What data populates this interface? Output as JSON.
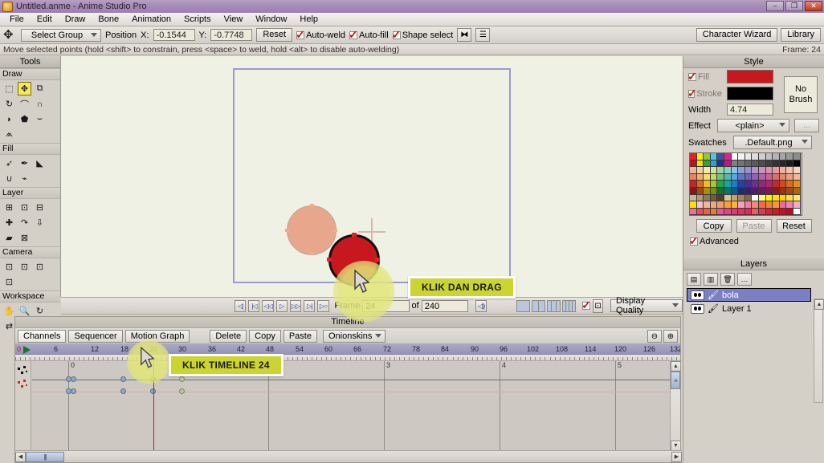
{
  "window": {
    "title": "Untitled.anme - Anime Studio Pro",
    "app_icon": "anime-studio-icon",
    "minimize": "–",
    "maximize": "❐",
    "close": "✕"
  },
  "menubar": {
    "items": [
      "File",
      "Edit",
      "Draw",
      "Bone",
      "Animation",
      "Scripts",
      "View",
      "Window",
      "Help"
    ]
  },
  "optionsbar": {
    "tool_icon": "move-tool-icon",
    "group_select": "Select Group",
    "position_label": "Position",
    "x_label": "X:",
    "x_value": "-0.1544",
    "y_label": "Y:",
    "y_value": "-0.7748",
    "reset": "Reset",
    "auto_weld": "Auto-weld",
    "auto_fill": "Auto-fill",
    "shape_select": "Shape select",
    "icon1": "flip-horizontal-icon",
    "icon2": "point-list-icon",
    "character_wizard": "Character Wizard",
    "library": "Library"
  },
  "statusbar": {
    "hint": "Move selected points (hold <shift> to constrain, press <space> to weld, hold <alt> to disable auto-welding)",
    "frame": "Frame: 24"
  },
  "tools": {
    "title": "Tools",
    "sections": [
      {
        "name": "Draw",
        "tools": [
          {
            "name": "select-points-tool",
            "glyph": "⬚",
            "selected": false
          },
          {
            "name": "translate-points-tool",
            "glyph": "✥",
            "selected": true
          },
          {
            "name": "scale-points-tool",
            "glyph": "⧉",
            "selected": false
          },
          {
            "name": "rotate-points-tool",
            "glyph": "↻",
            "selected": false
          },
          {
            "name": "add-point-tool",
            "glyph": "⌒",
            "selected": false
          },
          {
            "name": "curvature-tool",
            "glyph": "∩",
            "selected": false
          },
          {
            "name": "delete-edge-tool",
            "glyph": "◗",
            "selected": false
          },
          {
            "name": "perspective-points-tool",
            "glyph": "⬟",
            "selected": false
          },
          {
            "name": "bend-points-tool",
            "glyph": "⌣",
            "selected": false
          },
          {
            "name": "noise-tool",
            "glyph": "⩕",
            "selected": false
          }
        ]
      },
      {
        "name": "Fill",
        "tools": [
          {
            "name": "select-shape-tool",
            "glyph": "➶",
            "selected": false
          },
          {
            "name": "create-shape-tool",
            "glyph": "✒",
            "selected": false
          },
          {
            "name": "paint-bucket-tool",
            "glyph": "◣",
            "selected": false
          },
          {
            "name": "line-width-tool",
            "glyph": "∪",
            "selected": false
          },
          {
            "name": "hide-edge-tool",
            "glyph": "⌁",
            "selected": false
          }
        ]
      },
      {
        "name": "Layer",
        "tools": [
          {
            "name": "translate-layer-tool",
            "glyph": "⊞",
            "selected": false
          },
          {
            "name": "scale-layer-tool",
            "glyph": "⊡",
            "selected": false
          },
          {
            "name": "rotate-layer-z-tool",
            "glyph": "⊟",
            "selected": false
          },
          {
            "name": "add-layer-tool",
            "glyph": "✚",
            "selected": false
          },
          {
            "name": "rotate-layer-x-tool",
            "glyph": "↷",
            "selected": false
          },
          {
            "name": "rotate-layer-y-tool",
            "glyph": "⇩",
            "selected": false
          },
          {
            "name": "shear-layer-tool",
            "glyph": "▰",
            "selected": false
          },
          {
            "name": "set-origin-tool",
            "glyph": "⊠",
            "selected": false
          }
        ]
      },
      {
        "name": "Camera",
        "tools": [
          {
            "name": "track-camera-tool",
            "glyph": "⊡",
            "selected": false
          },
          {
            "name": "zoom-camera-tool",
            "glyph": "⊡",
            "selected": false
          },
          {
            "name": "roll-camera-tool",
            "glyph": "⊡",
            "selected": false
          },
          {
            "name": "pan-tilt-camera-tool",
            "glyph": "⊡",
            "selected": false
          }
        ]
      },
      {
        "name": "Workspace",
        "tools": [
          {
            "name": "pan-workspace-tool",
            "glyph": "✋",
            "selected": false
          },
          {
            "name": "zoom-workspace-tool",
            "glyph": "🔍",
            "selected": false
          },
          {
            "name": "rotate-workspace-tool",
            "glyph": "↻",
            "selected": false
          },
          {
            "name": "orbit-workspace-tool",
            "glyph": "⇄",
            "selected": false
          }
        ]
      }
    ]
  },
  "canvas": {
    "background": "#f0f1e5",
    "document_border": "#9a9acd",
    "origin_marker": "origin-crosshair",
    "shapes": [
      {
        "name": "onion-skin-ball",
        "fill": "#e8a68c",
        "stroke": "#b9a89e"
      },
      {
        "name": "selected-ball",
        "fill": "#c7181f",
        "stroke": "#111111"
      }
    ]
  },
  "playback": {
    "buttons": [
      {
        "name": "rewind-to-start-button",
        "glyph": "◁|"
      },
      {
        "name": "previous-keyframe-button",
        "glyph": "|◁"
      },
      {
        "name": "step-back-button",
        "glyph": "◁◁"
      },
      {
        "name": "play-button",
        "glyph": "▷"
      },
      {
        "name": "step-forward-button",
        "glyph": "▷▷"
      },
      {
        "name": "next-keyframe-button",
        "glyph": "▷|"
      },
      {
        "name": "go-to-end-button",
        "glyph": "▷○"
      }
    ],
    "frame_label": "Frame",
    "frame_value": "24",
    "of_label": "of",
    "total_value": "240",
    "sound_icon": "speaker-icon",
    "view_layouts": [
      "single-view-icon",
      "two-view-icon",
      "three-view-icon",
      "four-view-icon"
    ],
    "enable_checkbox": "enabled-check",
    "crop_icon": "crop-icon",
    "display_quality": "Display Quality"
  },
  "timeline": {
    "title": "Timeline",
    "tabs": [
      {
        "label": "Channels",
        "active": true
      },
      {
        "label": "Sequencer",
        "active": false
      },
      {
        "label": "Motion Graph",
        "active": false
      }
    ],
    "buttons": [
      "Delete",
      "Copy",
      "Paste"
    ],
    "onionskins": "Onionskins",
    "zoom_out_icon": "zoom-out-icon",
    "zoom_in_icon": "zoom-in-icon",
    "ruler_start": "0",
    "ruler_ticks": [
      6,
      12,
      18,
      24,
      30,
      36,
      42,
      48,
      54,
      60,
      66,
      72,
      78,
      84,
      90,
      96,
      102,
      108,
      114,
      120,
      126,
      132
    ],
    "value_gridlines": [
      "0",
      "3",
      "4",
      "5"
    ],
    "playhead_frame": 24,
    "tracks": [
      {
        "name": "layer-translation-channel",
        "color": "#6b6b6b",
        "keyframes": [
          0,
          2,
          12,
          18,
          24
        ]
      },
      {
        "name": "layer-visibility-channel",
        "color": "#e8a7a7",
        "keyframes": [
          0,
          2,
          12,
          18,
          24
        ]
      }
    ],
    "hscroll_left_icon": "scroll-left-icon",
    "hscroll_right_icon": "scroll-right-icon",
    "vscroll_up_icon": "scroll-up-icon",
    "vscroll_down_icon": "scroll-down-icon"
  },
  "style": {
    "title": "Style",
    "fill_label": "Fill",
    "fill_color": "#c7181f",
    "stroke_label": "Stroke",
    "stroke_color": "#000000",
    "no_brush": "No Brush",
    "width_label": "Width",
    "width_value": "4.74",
    "effect_label": "Effect",
    "effect_value": "<plain>",
    "effect_more": "...",
    "swatches_label": "Swatches",
    "swatches_file": ".Default.png",
    "copy": "Copy",
    "paste": "Paste",
    "reset": "Reset",
    "advanced": "Advanced",
    "palette": [
      "#ee1c24",
      "#fff200",
      "#8dc63f",
      "#4dc8e8",
      "#3a53a4",
      "#d9268f",
      "#ffffff",
      "#f2f2f2",
      "#e8e8e8",
      "#dddddd",
      "#cfcfcf",
      "#c0c0c0",
      "#b3b3b3",
      "#a6a6a6",
      "#999999",
      "#8c8c8c",
      "#c1101a",
      "#efe100",
      "#2fa344",
      "#2f9fd4",
      "#27307e",
      "#c0177f",
      "#808080",
      "#737373",
      "#666666",
      "#595959",
      "#4d4d4d",
      "#404040",
      "#333333",
      "#262626",
      "#1a1a1a",
      "#000000",
      "#f0b596",
      "#f2cfa4",
      "#f5e9a8",
      "#d3e39a",
      "#9fd3a3",
      "#88cfc6",
      "#8cc4e8",
      "#8e9ed6",
      "#9c92c9",
      "#b292c9",
      "#c792c0",
      "#d993ab",
      "#e89a9a",
      "#efb09e",
      "#f3c2ad",
      "#f7d5c1",
      "#e8855e",
      "#efb06a",
      "#f4dc70",
      "#bedc6e",
      "#72c27e",
      "#53b9ae",
      "#5aa8dd",
      "#5f76c4",
      "#7562b3",
      "#9462b3",
      "#b262a8",
      "#c96390",
      "#d96f6f",
      "#e4886a",
      "#ecA07f",
      "#f2b898",
      "#cc2026",
      "#e06a1c",
      "#f0c018",
      "#a8c91f",
      "#1fa64a",
      "#12a89c",
      "#1b7fc4",
      "#2a3f9e",
      "#4b2d91",
      "#6e2d91",
      "#92287f",
      "#b02570",
      "#c62828",
      "#d24a22",
      "#dd6b1c",
      "#e88c1a",
      "#8f1418",
      "#a04a14",
      "#b08a10",
      "#78900f",
      "#157033",
      "#0c7469",
      "#12588a",
      "#1c2c70",
      "#351f66",
      "#4e1f66",
      "#671b5a",
      "#7c1a50",
      "#8c1c1c",
      "#95350f",
      "#9d4d14",
      "#a96714",
      "#c9b79a",
      "#b09a78",
      "#8f7a58",
      "#6f5c40",
      "#4f3f2a",
      "#d9c49c",
      "#c0a47a",
      "#a3855c",
      "#86693f",
      "#ffffff",
      "#fff47a",
      "#fff200",
      "#ffe000",
      "#ffd000",
      "#ffdf3f",
      "#ffea5c",
      "#ffe100",
      "#f2c0d8",
      "#f3b49c",
      "#f4a582",
      "#f59b6b",
      "#f5a623",
      "#f7b733",
      "#f2a0c0",
      "#ef7fa8",
      "#f08a72",
      "#f06a4a",
      "#f2803a",
      "#f79c2a",
      "#e86ab0",
      "#e985b9",
      "#f4a9c7",
      "#ef6e93",
      "#ee4b5a",
      "#ef5d3a",
      "#f07a2a",
      "#ee4fa0",
      "#ea3d8f",
      "#e7357d",
      "#e62d6b",
      "#e4265a",
      "#ef5c5c",
      "#e63946",
      "#e02030",
      "#d61826",
      "#cc1020",
      "#c40a1a",
      "#ffffff"
    ]
  },
  "layers": {
    "title": "Layers",
    "toolbar": [
      {
        "name": "new-layer-button",
        "glyph": "▤"
      },
      {
        "name": "duplicate-layer-button",
        "glyph": "▥"
      },
      {
        "name": "delete-layer-button",
        "glyph": "🗑"
      },
      {
        "name": "layer-options-button",
        "glyph": "…"
      }
    ],
    "rows": [
      {
        "name": "bola",
        "visibility_icon": "eye-icon",
        "type_icon": "vector-layer-icon",
        "selected": true
      },
      {
        "name": "Layer 1",
        "visibility_icon": "eye-icon",
        "type_icon": "vector-layer-icon",
        "selected": false
      }
    ]
  },
  "annotations": [
    {
      "name": "klik-dan-drag-callout",
      "text": "KLIK DAN DRAG"
    },
    {
      "name": "klik-timeline-callout",
      "text": "KLIK TIMELINE 24"
    }
  ]
}
